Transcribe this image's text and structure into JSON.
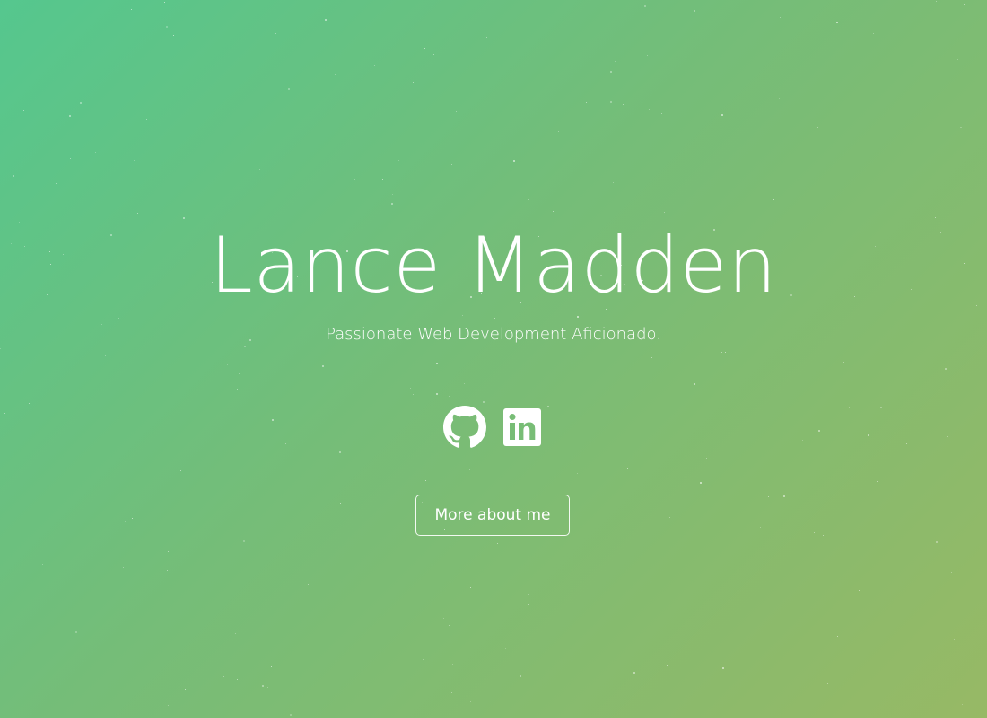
{
  "hero": {
    "name": "Lance Madden",
    "tagline": "Passionate Web Development Aficionado.",
    "cta_label": "More about me"
  },
  "socials": [
    {
      "icon": "github-icon",
      "label": "GitHub"
    },
    {
      "icon": "linkedin-icon",
      "label": "LinkedIn"
    }
  ],
  "colors": {
    "gradient_start": "#55c78e",
    "gradient_mid": "#75bd78",
    "gradient_end": "#97b965",
    "text": "#ffffff"
  }
}
